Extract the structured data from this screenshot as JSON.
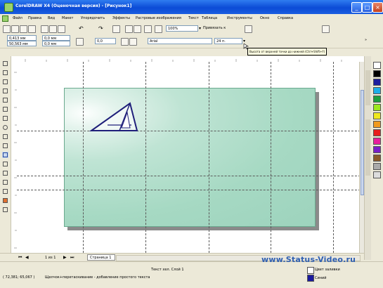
{
  "window": {
    "title": "CorelDRAW X4 (Оценочная версия) - [Рисунок1]"
  },
  "menubar": {
    "items": [
      "Файл",
      "Правка",
      "Вид",
      "Макет",
      "Упорядочить",
      "Эффекты",
      "Растровые изображения",
      "Текст",
      "Таблица",
      "Инструменты",
      "Окно",
      "Справка"
    ]
  },
  "toolbar": {
    "zoom": "100%",
    "snap_label": "Привязать к"
  },
  "propbar": {
    "x": "0,413 мм",
    "y": "50,563 мм",
    "w": "0,0 мм",
    "h": "0,0 мм",
    "angle": "0,0",
    "font_name": "Arial",
    "font_size": "24 п."
  },
  "tooltip": {
    "text": "Высота от верхней точки до нижней (Ctrl+Shift+F)"
  },
  "pagebar": {
    "counter": "1 из 1",
    "tab": "Страница 1"
  },
  "status": {
    "line1": "Текст хел. Слой 1",
    "coords": "( 72,381; 65,067 )",
    "hint": "Щелчок+перетаскивание - добавление простого текста",
    "fill_label": "Цвет заливки",
    "outline_label": "Синий"
  },
  "watermark": {
    "text": "www.Status-Video.ru"
  },
  "colors": {
    "rect_fill": "#a6d9c3",
    "triangle": "#1f1f7a",
    "outline": "#1a1a9e"
  },
  "icons": [
    "new-icon",
    "open-icon",
    "save-icon",
    "print-icon",
    "cut-icon",
    "copy-icon",
    "paste-icon",
    "undo-icon",
    "redo-icon",
    "import-icon",
    "export-icon",
    "zoom-dropdown-icon",
    "pick-tool-icon",
    "shape-tool-icon",
    "crop-tool-icon",
    "zoom-tool-icon",
    "freehand-tool-icon",
    "smart-fill-icon",
    "rectangle-tool-icon",
    "ellipse-tool-icon",
    "polygon-tool-icon",
    "basic-shapes-icon",
    "text-tool-icon",
    "table-tool-icon",
    "interactive-blend-icon",
    "eyedropper-icon",
    "outline-tool-icon",
    "fill-tool-icon"
  ]
}
